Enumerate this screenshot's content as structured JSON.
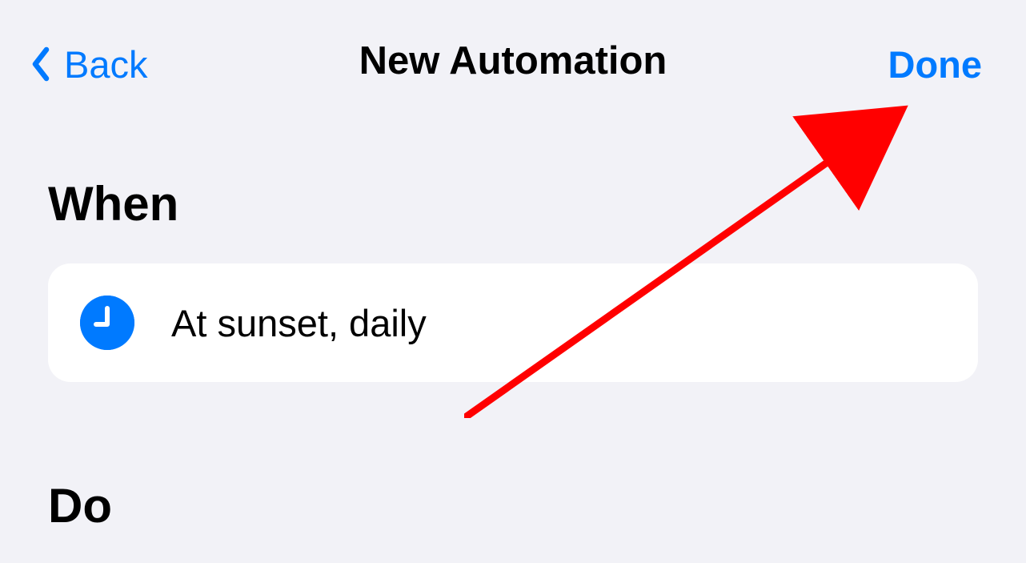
{
  "nav": {
    "back_label": "Back",
    "title": "New Automation",
    "done_label": "Done"
  },
  "sections": {
    "when": {
      "heading": "When",
      "item_text": "At sunset, daily"
    },
    "do": {
      "heading": "Do"
    }
  }
}
